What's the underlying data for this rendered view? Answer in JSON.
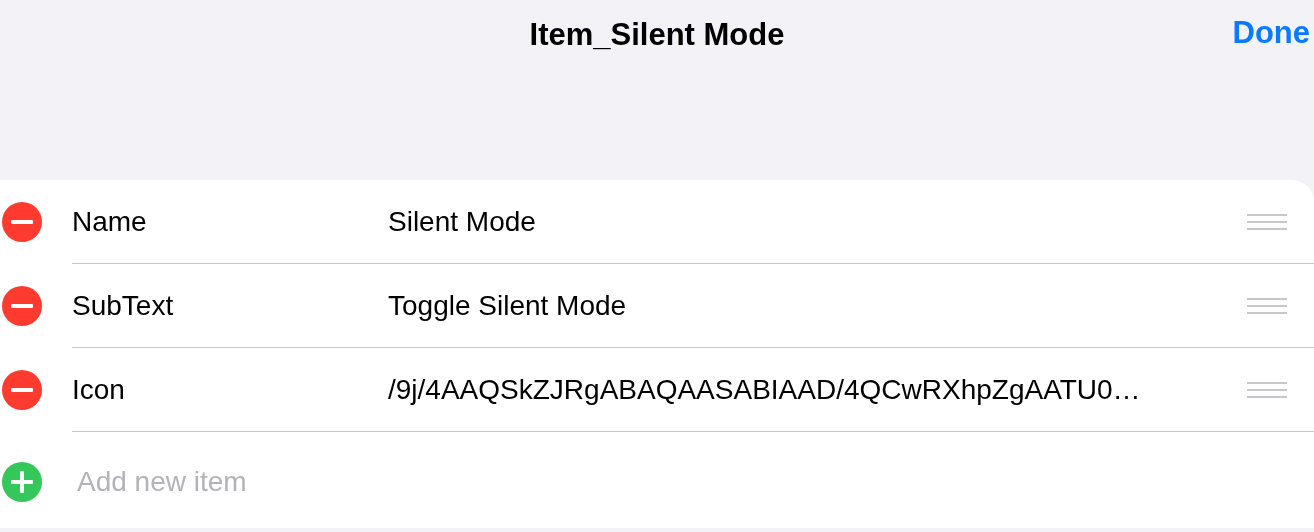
{
  "navigation_bar": {
    "title": "Item_Silent Mode",
    "done_button": "Done"
  },
  "rows": [
    {
      "label": "Name",
      "value": "Silent Mode"
    },
    {
      "label": "SubText",
      "value": "Toggle Silent Mode"
    },
    {
      "label": "Icon",
      "value": "/9j/4AAQSkZJRgABAQAASABIAAD/4QCwRXhpZgAATU0…"
    }
  ],
  "add_button": {
    "label": "Add new item"
  }
}
